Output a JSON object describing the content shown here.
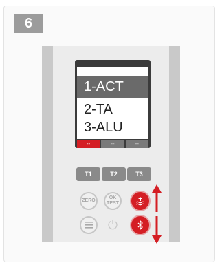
{
  "step": {
    "number": "6"
  },
  "display": {
    "menu": [
      "1-ACT",
      "2-TA",
      "3-ALU"
    ],
    "selected_index": 0,
    "softkeys": [
      "--",
      "--",
      "--"
    ]
  },
  "keypad": {
    "t_buttons": [
      "T1",
      "T2",
      "T3"
    ],
    "zero_label": "ZERO",
    "ok_line1": "OK",
    "ok_line2": "TEST"
  },
  "icons": {
    "menu": "hamburger-menu-icon",
    "power": "power-icon",
    "upload": "upload-water-icon",
    "bluetooth": "bluetooth-icon",
    "arrows": "red-up-down-arrow-icon"
  },
  "colors": {
    "accent_red": "#d41e24",
    "step_badge": "#9c9c9c",
    "button_grey": "#8a8a8a"
  }
}
